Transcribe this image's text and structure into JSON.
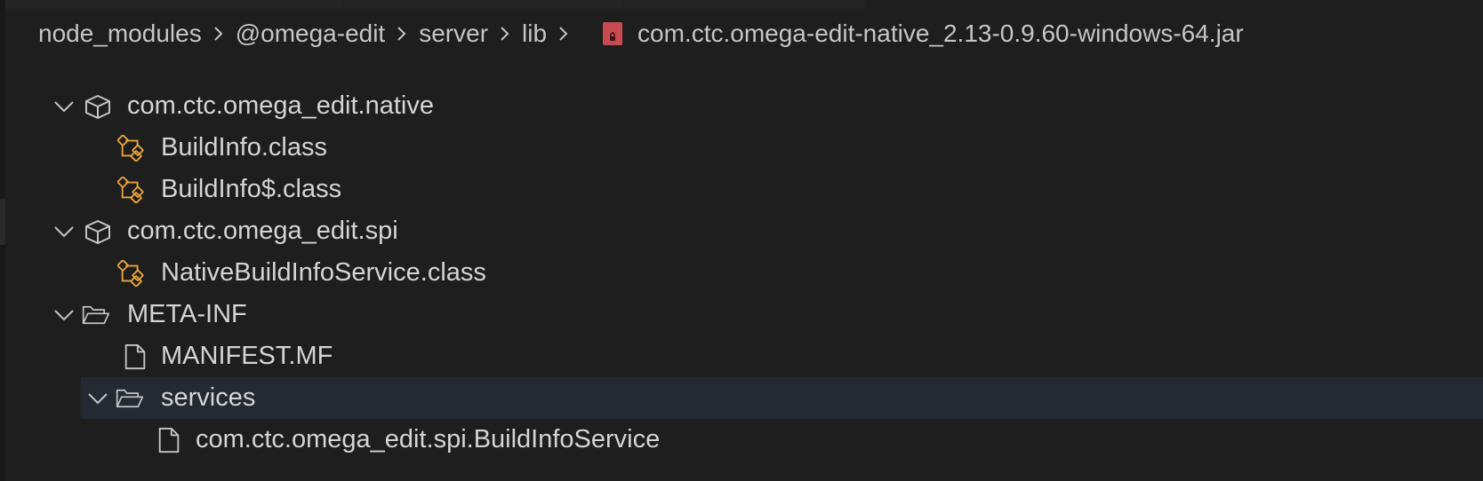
{
  "breadcrumb": {
    "items": [
      "node_modules",
      "@omega-edit",
      "server",
      "lib"
    ],
    "file": "com.ctc.omega-edit-native_2.13-0.9.60-windows-64.jar",
    "file_icon": "jar-file-icon"
  },
  "tree": {
    "pkg_native": "com.ctc.omega_edit.native",
    "buildinfo_class": "BuildInfo.class",
    "buildinfo_dollar_class": "BuildInfo$.class",
    "pkg_spi": "com.ctc.omega_edit.spi",
    "native_service_class": "NativeBuildInfoService.class",
    "meta_inf": "META-INF",
    "manifest": "MANIFEST.MF",
    "services": "services",
    "service_file": "com.ctc.omega_edit.spi.BuildInfoService"
  },
  "colors": {
    "background": "#1e1e1e",
    "selection": "#242a33",
    "class_icon": "#e8a33d",
    "jar_icon": "#c74b50"
  }
}
